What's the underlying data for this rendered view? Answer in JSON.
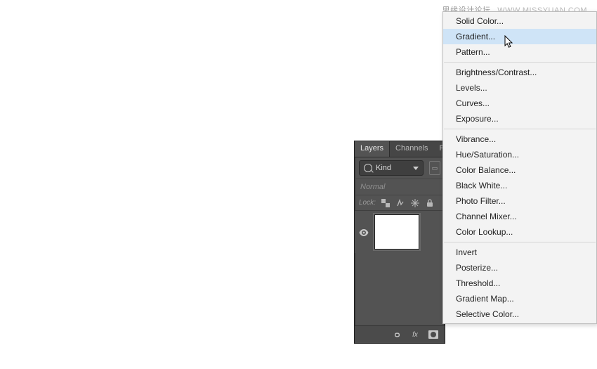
{
  "watermark": {
    "cn": "思缘设计论坛",
    "en": "WWW.MISSYUAN.COM"
  },
  "layers_panel": {
    "tabs": [
      {
        "label": "Layers",
        "active": true
      },
      {
        "label": "Channels",
        "active": false
      },
      {
        "label": "P",
        "active": false
      }
    ],
    "filter": {
      "kind_label": "Kind"
    },
    "blend_mode": "Normal",
    "lock_label": "Lock:",
    "footer_fx": "fx"
  },
  "context_menu": {
    "groups": [
      [
        {
          "id": "solid-color",
          "label": "Solid Color..."
        },
        {
          "id": "gradient",
          "label": "Gradient...",
          "hover": true
        },
        {
          "id": "pattern",
          "label": "Pattern..."
        }
      ],
      [
        {
          "id": "brightness-contrast",
          "label": "Brightness/Contrast..."
        },
        {
          "id": "levels",
          "label": "Levels..."
        },
        {
          "id": "curves",
          "label": "Curves..."
        },
        {
          "id": "exposure",
          "label": "Exposure..."
        }
      ],
      [
        {
          "id": "vibrance",
          "label": "Vibrance..."
        },
        {
          "id": "hue-saturation",
          "label": "Hue/Saturation..."
        },
        {
          "id": "color-balance",
          "label": "Color Balance..."
        },
        {
          "id": "black-white",
          "label": "Black  White..."
        },
        {
          "id": "photo-filter",
          "label": "Photo Filter..."
        },
        {
          "id": "channel-mixer",
          "label": "Channel Mixer..."
        },
        {
          "id": "color-lookup",
          "label": "Color Lookup..."
        }
      ],
      [
        {
          "id": "invert",
          "label": "Invert"
        },
        {
          "id": "posterize",
          "label": "Posterize..."
        },
        {
          "id": "threshold",
          "label": "Threshold..."
        },
        {
          "id": "gradient-map",
          "label": "Gradient Map..."
        },
        {
          "id": "selective-color",
          "label": "Selective Color..."
        }
      ]
    ]
  }
}
